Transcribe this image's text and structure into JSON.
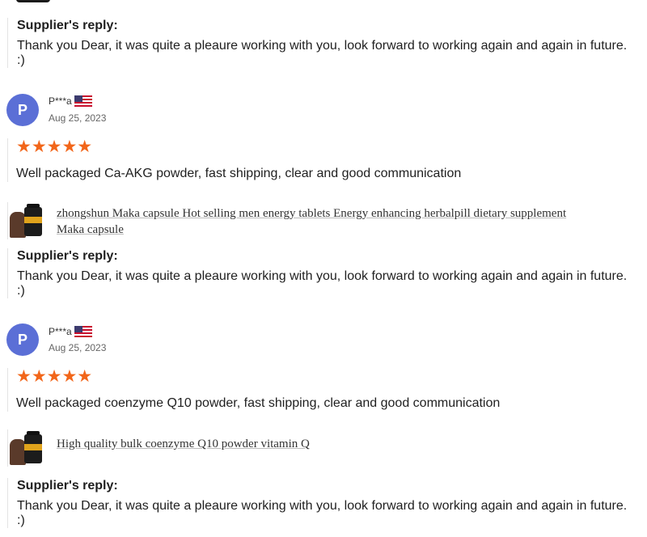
{
  "reviews": [
    {
      "initial": "P",
      "name": "P***a",
      "date": "Aug 25, 2023",
      "stars": "★★★★★",
      "text": "Well packaged Ca-AKG powder, fast shipping, clear and good communication",
      "product": "zhongshun Maka capsule Hot selling men energy tablets Energy enhancing herbalpill dietary supplement Maka capsule"
    },
    {
      "initial": "P",
      "name": "P***a",
      "date": "Aug 25, 2023",
      "stars": "★★★★★",
      "text": "Well packaged coenzyme Q10 powder, fast shipping, clear and good communication",
      "product": "High quality bulk coenzyme Q10 powder vitamin Q"
    }
  ],
  "replies": [
    {
      "title": "Supplier's reply:",
      "text": "Thank you Dear, it was quite a pleaure working with you, look forward to working again and again in future. :)"
    },
    {
      "title": "Supplier's reply:",
      "text": "Thank you Dear, it was quite a pleaure working with you, look forward to working again and again in future. :)"
    },
    {
      "title": "Supplier's reply:",
      "text": "Thank you Dear, it was quite a pleaure working with you, look forward to working again and again in future. :)"
    }
  ],
  "colors": {
    "star": "#f2661a",
    "avatar": "#5b6fd6"
  },
  "icons": {
    "flag": "us-flag-icon",
    "rating": "star-icon"
  }
}
